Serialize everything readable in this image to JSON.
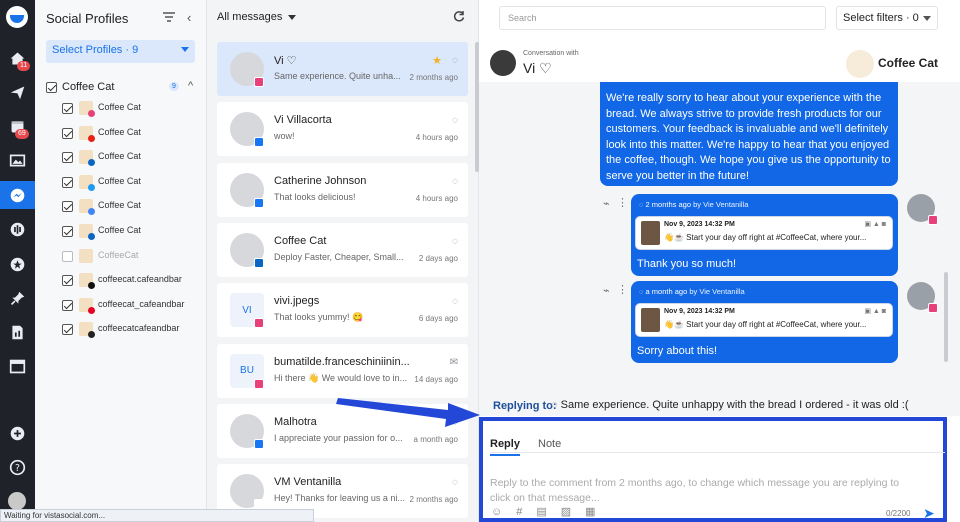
{
  "rail": {
    "badges": {
      "publish": "11",
      "calendar": "69"
    }
  },
  "profiles": {
    "title": "Social Profiles",
    "select_label": "Select Profiles · 9",
    "group_name": "Coffee Cat",
    "group_count": "9",
    "items": [
      {
        "label": "Coffee Cat",
        "net": "instagram",
        "checked": true
      },
      {
        "label": "Coffee Cat",
        "net": "youtube",
        "checked": true
      },
      {
        "label": "Coffee Cat",
        "net": "linkedin",
        "checked": true
      },
      {
        "label": "Coffee Cat",
        "net": "twitter",
        "checked": true
      },
      {
        "label": "Coffee Cat",
        "net": "gmb",
        "checked": true
      },
      {
        "label": "Coffee Cat",
        "net": "linkedin",
        "checked": true
      },
      {
        "label": "CoffeeCat",
        "net": "none",
        "checked": false
      },
      {
        "label": "coffeecat.cafeandbar",
        "net": "tiktok",
        "checked": true
      },
      {
        "label": "coffeecat_cafeandbar",
        "net": "pinterest",
        "checked": true
      },
      {
        "label": "coffeecatcafeandbar",
        "net": "threads",
        "checked": true
      }
    ]
  },
  "messages": {
    "filter_label": "All messages",
    "cards": [
      {
        "name": "Vi ♡",
        "preview": "Same experience. Quite unha...",
        "time": "2 months ago",
        "avatar": "",
        "selected": true,
        "starred": true,
        "net": "instagram"
      },
      {
        "name": "Vi Villacorta",
        "preview": "wow!",
        "time": "4 hours ago",
        "avatar": "",
        "net": "facebook"
      },
      {
        "name": "Catherine Johnson",
        "preview": "That looks delicious!",
        "time": "4 hours ago",
        "avatar": "",
        "net": "facebook"
      },
      {
        "name": "Coffee Cat",
        "preview": "Deploy Faster, Cheaper, Small...",
        "time": "2 days ago",
        "avatar": "",
        "net": "linkedin"
      },
      {
        "name": "vivi.jpegs",
        "preview": "That looks yummy! 😋",
        "time": "6 days ago",
        "avatar": "VI",
        "net": "instagram"
      },
      {
        "name": "bumatilde.franceschiniinin...",
        "preview": "Hi there 👋 We would love to in...",
        "time": "14 days ago",
        "avatar": "BU",
        "net": "instagram",
        "mail": true
      },
      {
        "name": "Malhotra",
        "preview": "I appreciate your passion for o...",
        "time": "a month ago",
        "avatar": "",
        "net": "facebook"
      },
      {
        "name": "VM Ventanilla",
        "preview": "Hey! Thanks for leaving us a ni...",
        "time": "2 months ago",
        "avatar": "",
        "net": "google"
      }
    ]
  },
  "conversation": {
    "search_placeholder": "Search",
    "select_filters": "Select filters · 0",
    "with_label": "Conversation with",
    "contact_name": "Vi ♡",
    "account_name": "Coffee Cat",
    "main_reply": "We're really sorry to hear about your experience with the bread. We always strive to provide fresh products for our customers. Your feedback is invaluable and we'll definitely look into this matter. We're happy to hear that you enjoyed the coffee, though. We hope you give us the opportunity to serve you better in the future!",
    "replies": [
      {
        "time": "2 months ago",
        "by": "by Vie Ventanilla",
        "quote_date": "Nov 9, 2023 14:32 PM",
        "quote_text": "👋☕ Start your day off right at #CoffeeCat, where your...",
        "text": "Thank you so much!"
      },
      {
        "time": "a month ago",
        "by": "by Vie Ventanilla",
        "quote_date": "Nov 9, 2023 14:32 PM",
        "quote_text": "👋☕ Start your day off right at #CoffeeCat, where your...",
        "text": "Sorry about this!"
      }
    ],
    "replying_to_label": "Replying to:",
    "replying_to_text": "Same experience. Quite unhappy with the bread I ordered - it was old :(",
    "tab_reply": "Reply",
    "tab_note": "Note",
    "composer_placeholder": "Reply to the comment from 2 months ago, to change which message you are replying to click on that message...",
    "char_count": "0/2200"
  },
  "statusbar": "Waiting for vistasocial.com...",
  "colors": {
    "accent": "#1167e5",
    "rail": "#1f2329",
    "highlight": "#2347d6"
  }
}
